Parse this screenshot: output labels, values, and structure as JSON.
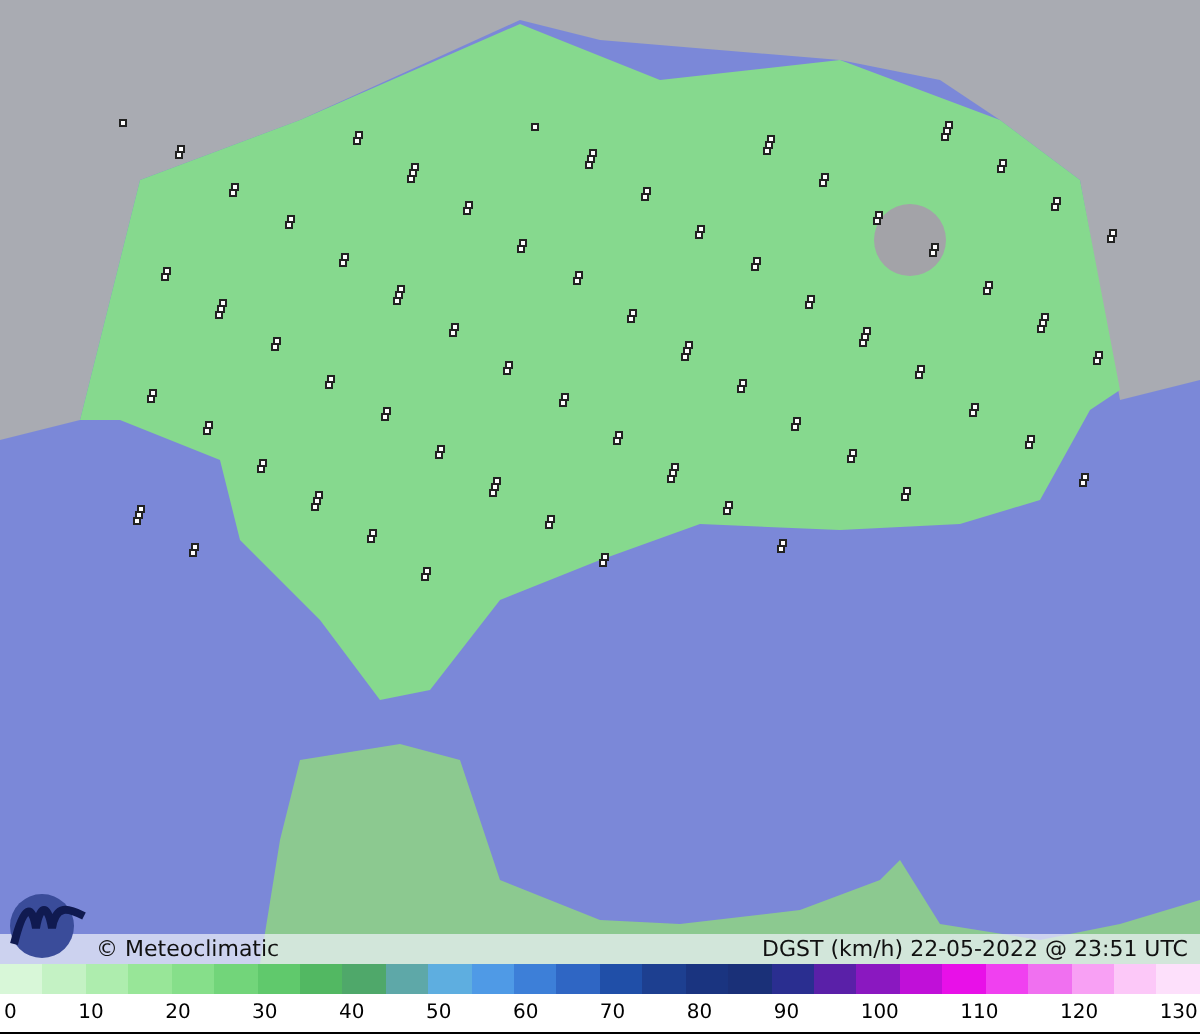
{
  "map": {
    "credit": "© Meteoclimatic",
    "title": "DGST (km/h)  22-05-2022 @ 23:51 UTC"
  },
  "scale": {
    "ticks": [
      "0",
      "10",
      "20",
      "30",
      "40",
      "50",
      "60",
      "70",
      "80",
      "90",
      "100",
      "110",
      "120",
      "130"
    ]
  }
}
